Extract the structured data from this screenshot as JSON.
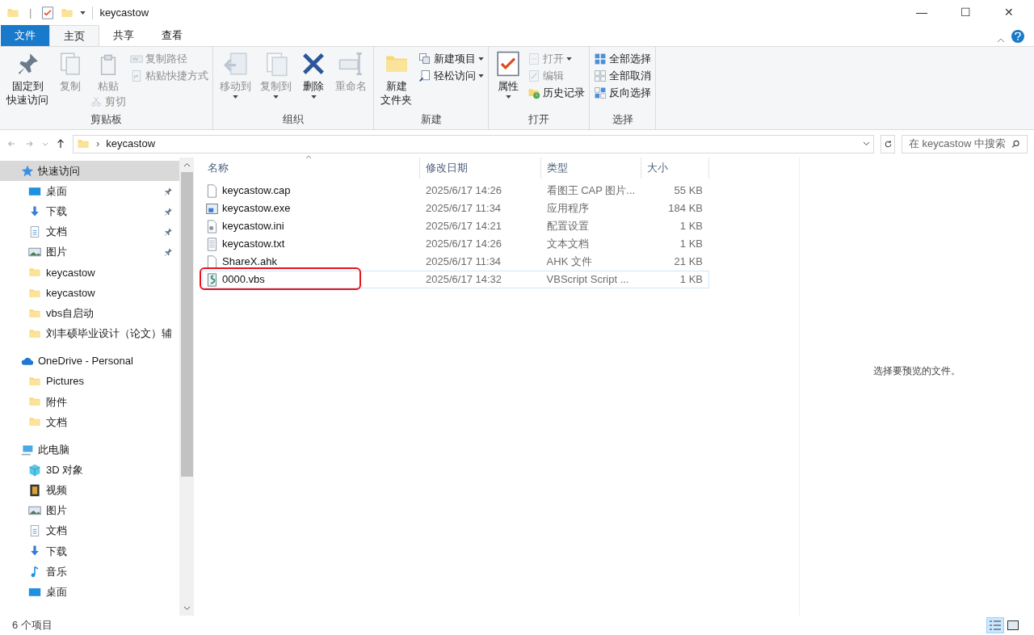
{
  "window": {
    "title": "keycastow",
    "qat_separator": "|",
    "controls": [
      "—",
      "☐",
      "✕"
    ]
  },
  "tabs": [
    {
      "label": "文件",
      "kind": "file",
      "selected": false
    },
    {
      "label": "主页",
      "kind": "tab",
      "selected": true
    },
    {
      "label": "共享",
      "kind": "tab",
      "selected": false
    },
    {
      "label": "查看",
      "kind": "tab",
      "selected": false
    }
  ],
  "ribbon": [
    {
      "label": "剪贴板",
      "items": [
        {
          "kind": "large",
          "lines": [
            "固定到",
            "快速访问"
          ],
          "disabled": false
        },
        {
          "kind": "large",
          "lines": [
            "复制"
          ],
          "disabled": true
        },
        {
          "kind": "stack",
          "items": [
            {
              "kind": "medium",
              "lines": [
                "粘贴"
              ],
              "disabled": true
            },
            {
              "kind": "small",
              "lines": [
                "剪切"
              ],
              "disabled": true
            }
          ]
        },
        {
          "kind": "stack",
          "items": [
            {
              "kind": "small",
              "lines": [
                "复制路径"
              ],
              "disabled": true
            },
            {
              "kind": "small",
              "lines": [
                "粘贴快捷方式"
              ],
              "disabled": true
            }
          ]
        }
      ]
    },
    {
      "label": "组织",
      "items": [
        {
          "kind": "large",
          "lines": [
            "移动到"
          ],
          "disabled": true,
          "dropdown": true
        },
        {
          "kind": "large",
          "lines": [
            "复制到"
          ],
          "disabled": true,
          "dropdown": true
        },
        {
          "kind": "large",
          "lines": [
            "删除"
          ],
          "disabled": false,
          "dropdown": true
        },
        {
          "kind": "large",
          "lines": [
            "重命名"
          ],
          "disabled": true
        }
      ]
    },
    {
      "label": "新建",
      "items": [
        {
          "kind": "large",
          "lines": [
            "新建",
            "文件夹"
          ],
          "disabled": false
        },
        {
          "kind": "stack",
          "items": [
            {
              "kind": "small",
              "lines": [
                "新建项目"
              ],
              "disabled": false,
              "dropdown": true
            },
            {
              "kind": "small",
              "lines": [
                "轻松访问"
              ],
              "disabled": false,
              "dropdown": true
            }
          ]
        }
      ]
    },
    {
      "label": "打开",
      "items": [
        {
          "kind": "large",
          "lines": [
            "属性"
          ],
          "disabled": false,
          "dropdown": true
        },
        {
          "kind": "stack",
          "items": [
            {
              "kind": "small",
              "lines": [
                "打开"
              ],
              "disabled": true,
              "dropdown": true
            },
            {
              "kind": "small",
              "lines": [
                "编辑"
              ],
              "disabled": true
            },
            {
              "kind": "small",
              "lines": [
                "历史记录"
              ],
              "disabled": false
            }
          ]
        }
      ]
    },
    {
      "label": "选择",
      "items": [
        {
          "kind": "stack",
          "items": [
            {
              "kind": "small",
              "lines": [
                "全部选择"
              ],
              "disabled": false
            },
            {
              "kind": "small",
              "lines": [
                "全部取消"
              ],
              "disabled": false
            },
            {
              "kind": "small",
              "lines": [
                "反向选择"
              ],
              "disabled": false
            }
          ]
        }
      ]
    }
  ],
  "address": {
    "separator": "›",
    "path": "keycastow",
    "search_placeholder": "在 keycastow 中搜索"
  },
  "sidebar": {
    "items": [
      {
        "label": "快速访问",
        "selected": true,
        "children": [
          {
            "label": "桌面",
            "pinned": true,
            "selected": false
          },
          {
            "label": "下载",
            "pinned": true,
            "selected": false
          },
          {
            "label": "文档",
            "pinned": true,
            "selected": false
          },
          {
            "label": "图片",
            "pinned": true,
            "selected": false
          },
          {
            "label": "keycastow",
            "pinned": false,
            "selected": false
          },
          {
            "label": "keycastow",
            "pinned": false,
            "selected": false
          },
          {
            "label": "vbs自启动",
            "pinned": false,
            "selected": false
          },
          {
            "label": "刘丰硕毕业设计（论文）辅",
            "pinned": false,
            "selected": false
          }
        ]
      },
      {
        "label": "OneDrive - Personal",
        "selected": false,
        "children": [
          {
            "label": "Pictures",
            "pinned": false,
            "selected": false
          },
          {
            "label": "附件",
            "pinned": false,
            "selected": false
          },
          {
            "label": "文档",
            "pinned": false,
            "selected": false
          }
        ]
      },
      {
        "label": "此电脑",
        "selected": false,
        "children": [
          {
            "label": "3D 对象",
            "pinned": false,
            "selected": false
          },
          {
            "label": "视频",
            "pinned": false,
            "selected": false
          },
          {
            "label": "图片",
            "pinned": false,
            "selected": false
          },
          {
            "label": "文档",
            "pinned": false,
            "selected": false
          },
          {
            "label": "下载",
            "pinned": false,
            "selected": false
          },
          {
            "label": "音乐",
            "pinned": false,
            "selected": false
          },
          {
            "label": "桌面",
            "pinned": false,
            "selected": false
          }
        ]
      }
    ]
  },
  "table": {
    "columns": [
      "名称",
      "修改日期",
      "类型",
      "大小"
    ],
    "rows": [
      {
        "name": "keycastow.cap",
        "date": "2025/6/17 14:26",
        "type": "看图王 CAP 图片...",
        "size": "55 KB",
        "selected": false,
        "highlighted": false
      },
      {
        "name": "keycastow.exe",
        "date": "2025/6/17 11:34",
        "type": "应用程序",
        "size": "184 KB",
        "selected": false,
        "highlighted": false
      },
      {
        "name": "keycastow.ini",
        "date": "2025/6/17 14:21",
        "type": "配置设置",
        "size": "1 KB",
        "selected": false,
        "highlighted": false
      },
      {
        "name": "keycastow.txt",
        "date": "2025/6/17 14:26",
        "type": "文本文档",
        "size": "1 KB",
        "selected": false,
        "highlighted": false
      },
      {
        "name": "ShareX.ahk",
        "date": "2025/6/17 11:34",
        "type": "AHK 文件",
        "size": "21 KB",
        "selected": false,
        "highlighted": false
      },
      {
        "name": "0000.vbs",
        "date": "2025/6/17 14:32",
        "type": "VBScript Script ...",
        "size": "1 KB",
        "selected": true,
        "highlighted": true
      }
    ]
  },
  "preview": {
    "message": "选择要预览的文件。"
  },
  "status_bar": {
    "count": "6 个项目"
  }
}
